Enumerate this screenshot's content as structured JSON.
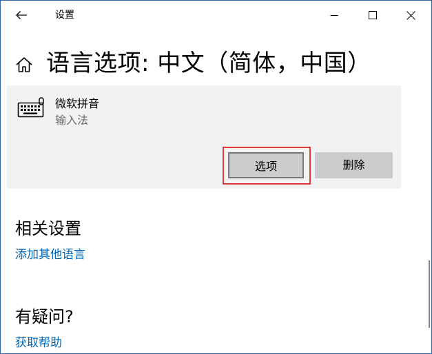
{
  "window": {
    "app_title": "设置",
    "back_icon": "arrow-left-icon",
    "minimize_icon": "minimize-icon",
    "maximize_icon": "maximize-icon",
    "close_icon": "close-icon"
  },
  "page": {
    "home_icon": "home-icon",
    "title": "语言选项: 中文（简体，中国）"
  },
  "keyboard": {
    "icon": "keyboard-icon",
    "name": "微软拼音",
    "type": "输入法",
    "options_label": "选项",
    "remove_label": "删除"
  },
  "related": {
    "title": "相关设置",
    "add_language_link": "添加其他语言"
  },
  "questions": {
    "title": "有疑问?",
    "help_link": "获取帮助"
  },
  "colors": {
    "accent_link": "#0067b8",
    "card_bg": "#f2f2f2",
    "button_bg": "#cccccc",
    "highlight": "#e03a3a"
  }
}
